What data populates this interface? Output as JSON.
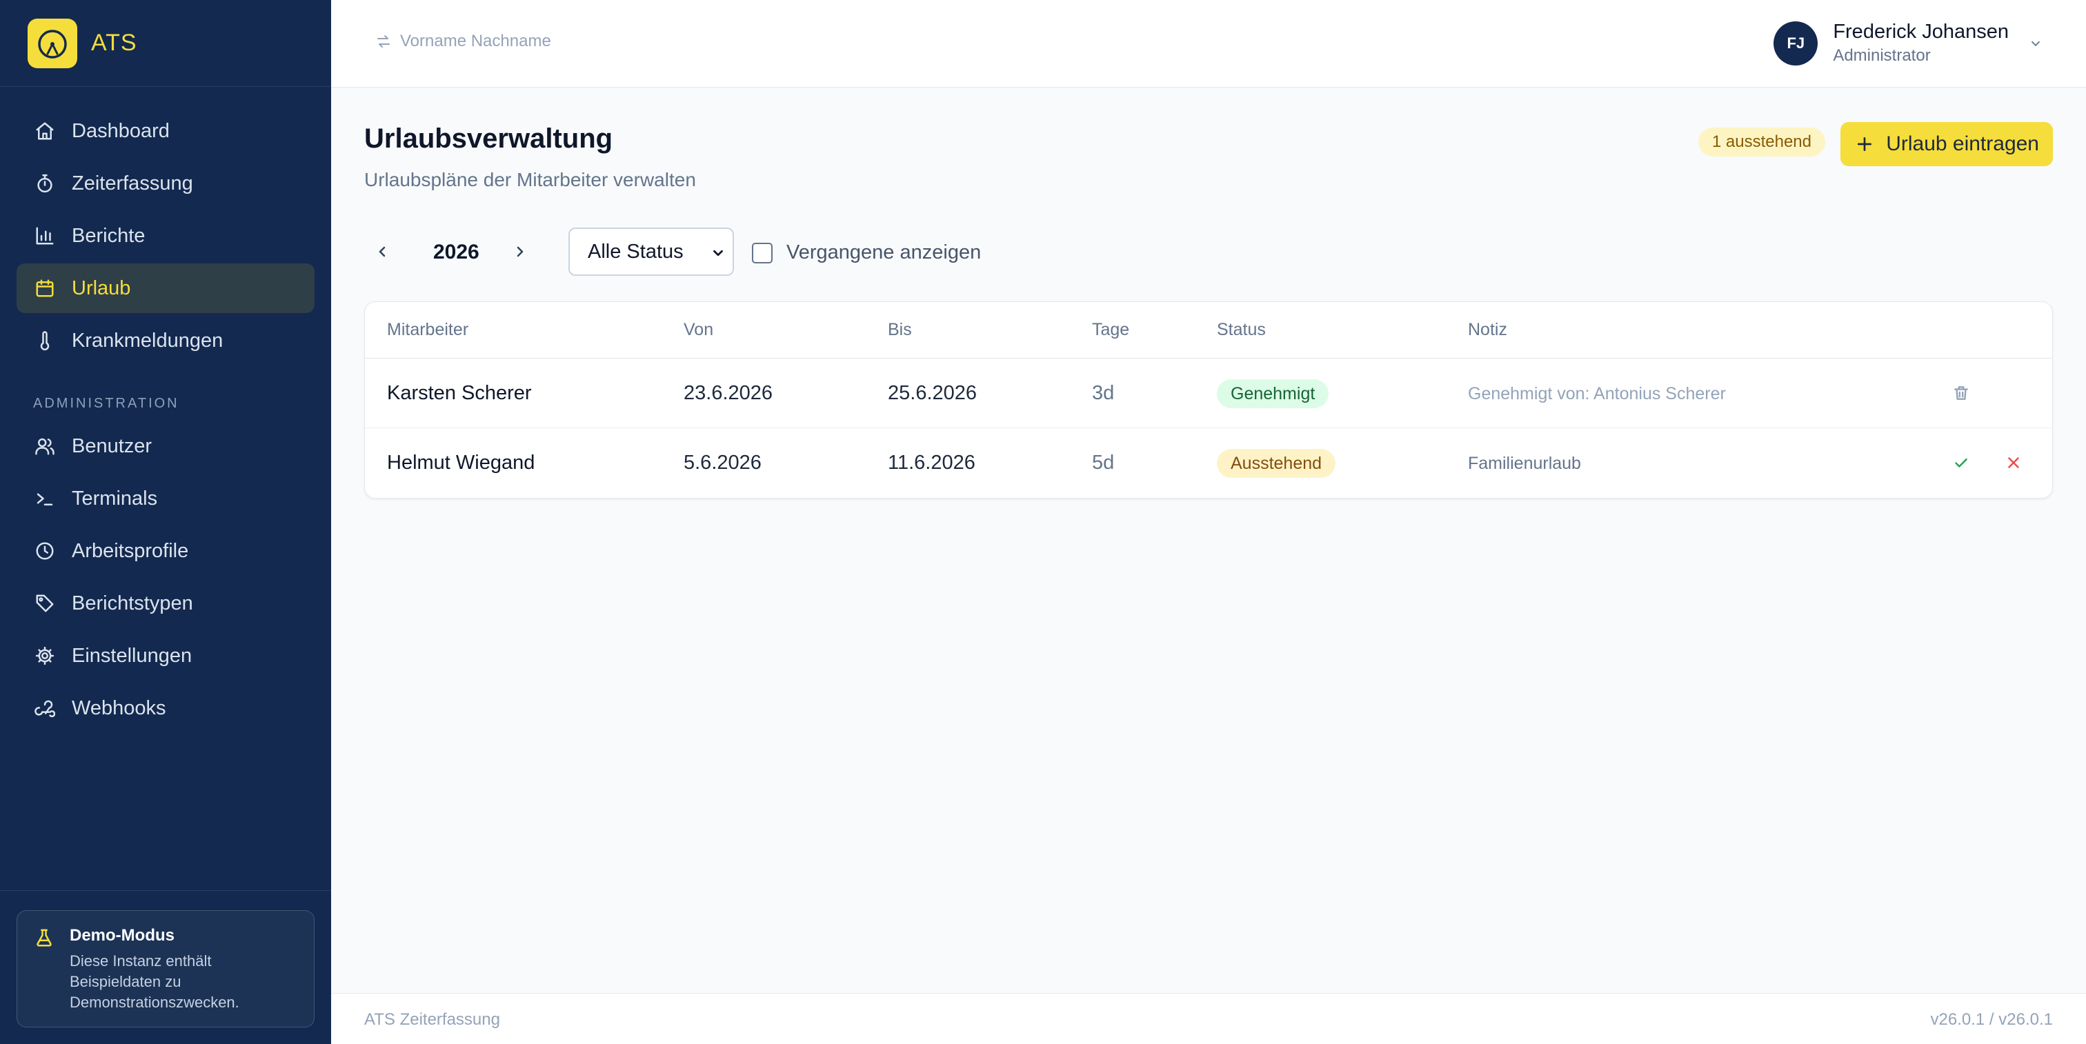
{
  "brand": {
    "name": "ATS",
    "color": "#f5dd3b",
    "icon": "gauge-icon"
  },
  "sidebar": {
    "items": [
      {
        "label": "Dashboard",
        "icon": "home-icon"
      },
      {
        "label": "Zeiterfassung",
        "icon": "stopwatch-icon"
      },
      {
        "label": "Berichte",
        "icon": "bar-chart-icon"
      },
      {
        "label": "Urlaub",
        "icon": "calendar-icon",
        "active": true
      },
      {
        "label": "Krankmeldungen",
        "icon": "thermometer-icon"
      }
    ],
    "admin_label": "ADMINISTRATION",
    "admin_items": [
      {
        "label": "Benutzer",
        "icon": "users-icon"
      },
      {
        "label": "Terminals",
        "icon": "terminal-icon"
      },
      {
        "label": "Arbeitsprofile",
        "icon": "clock-icon"
      },
      {
        "label": "Berichtstypen",
        "icon": "tag-icon"
      },
      {
        "label": "Einstellungen",
        "icon": "gear-icon"
      },
      {
        "label": "Webhooks",
        "icon": "webhook-icon"
      }
    ],
    "demo": {
      "title": "Demo-Modus",
      "text": "Diese Instanz enthält Beispieldaten zu Demonstrationszwecken.",
      "icon": "flask-icon"
    }
  },
  "topbar": {
    "switch_user_placeholder": "Vorname Nachname",
    "user": {
      "initials": "FJ",
      "name": "Frederick Johansen",
      "role": "Administrator"
    }
  },
  "page": {
    "title": "Urlaubsverwaltung",
    "subtitle": "Urlaubspläne der Mitarbeiter verwalten",
    "pending_badge": "1 ausstehend",
    "add_button": "Urlaub eintragen"
  },
  "filters": {
    "year": "2026",
    "status_selected": "Alle Status",
    "show_past_label": "Vergangene anzeigen",
    "show_past_checked": false
  },
  "table": {
    "headers": [
      "Mitarbeiter",
      "Von",
      "Bis",
      "Tage",
      "Status",
      "Notiz"
    ],
    "rows": [
      {
        "employee": "Karsten Scherer",
        "from": "23.6.2026",
        "to": "25.6.2026",
        "days": "3d",
        "status": "Genehmigt",
        "note": "Genehmigt von: Antonius Scherer",
        "actions": [
          "trash-icon"
        ]
      },
      {
        "employee": "Helmut Wiegand",
        "from": "5.6.2026",
        "to": "11.6.2026",
        "days": "5d",
        "status": "Ausstehend",
        "note": "Familienurlaub",
        "actions": [
          "check-icon",
          "close-icon"
        ]
      }
    ]
  },
  "footer": {
    "left": "ATS Zeiterfassung",
    "right": "v26.0.1 / v26.0.1"
  },
  "colors": {
    "sidebar_bg": "#13294f",
    "accent": "#f5dd3b",
    "approved": "#dcfce7",
    "pending": "#fef3c7"
  }
}
